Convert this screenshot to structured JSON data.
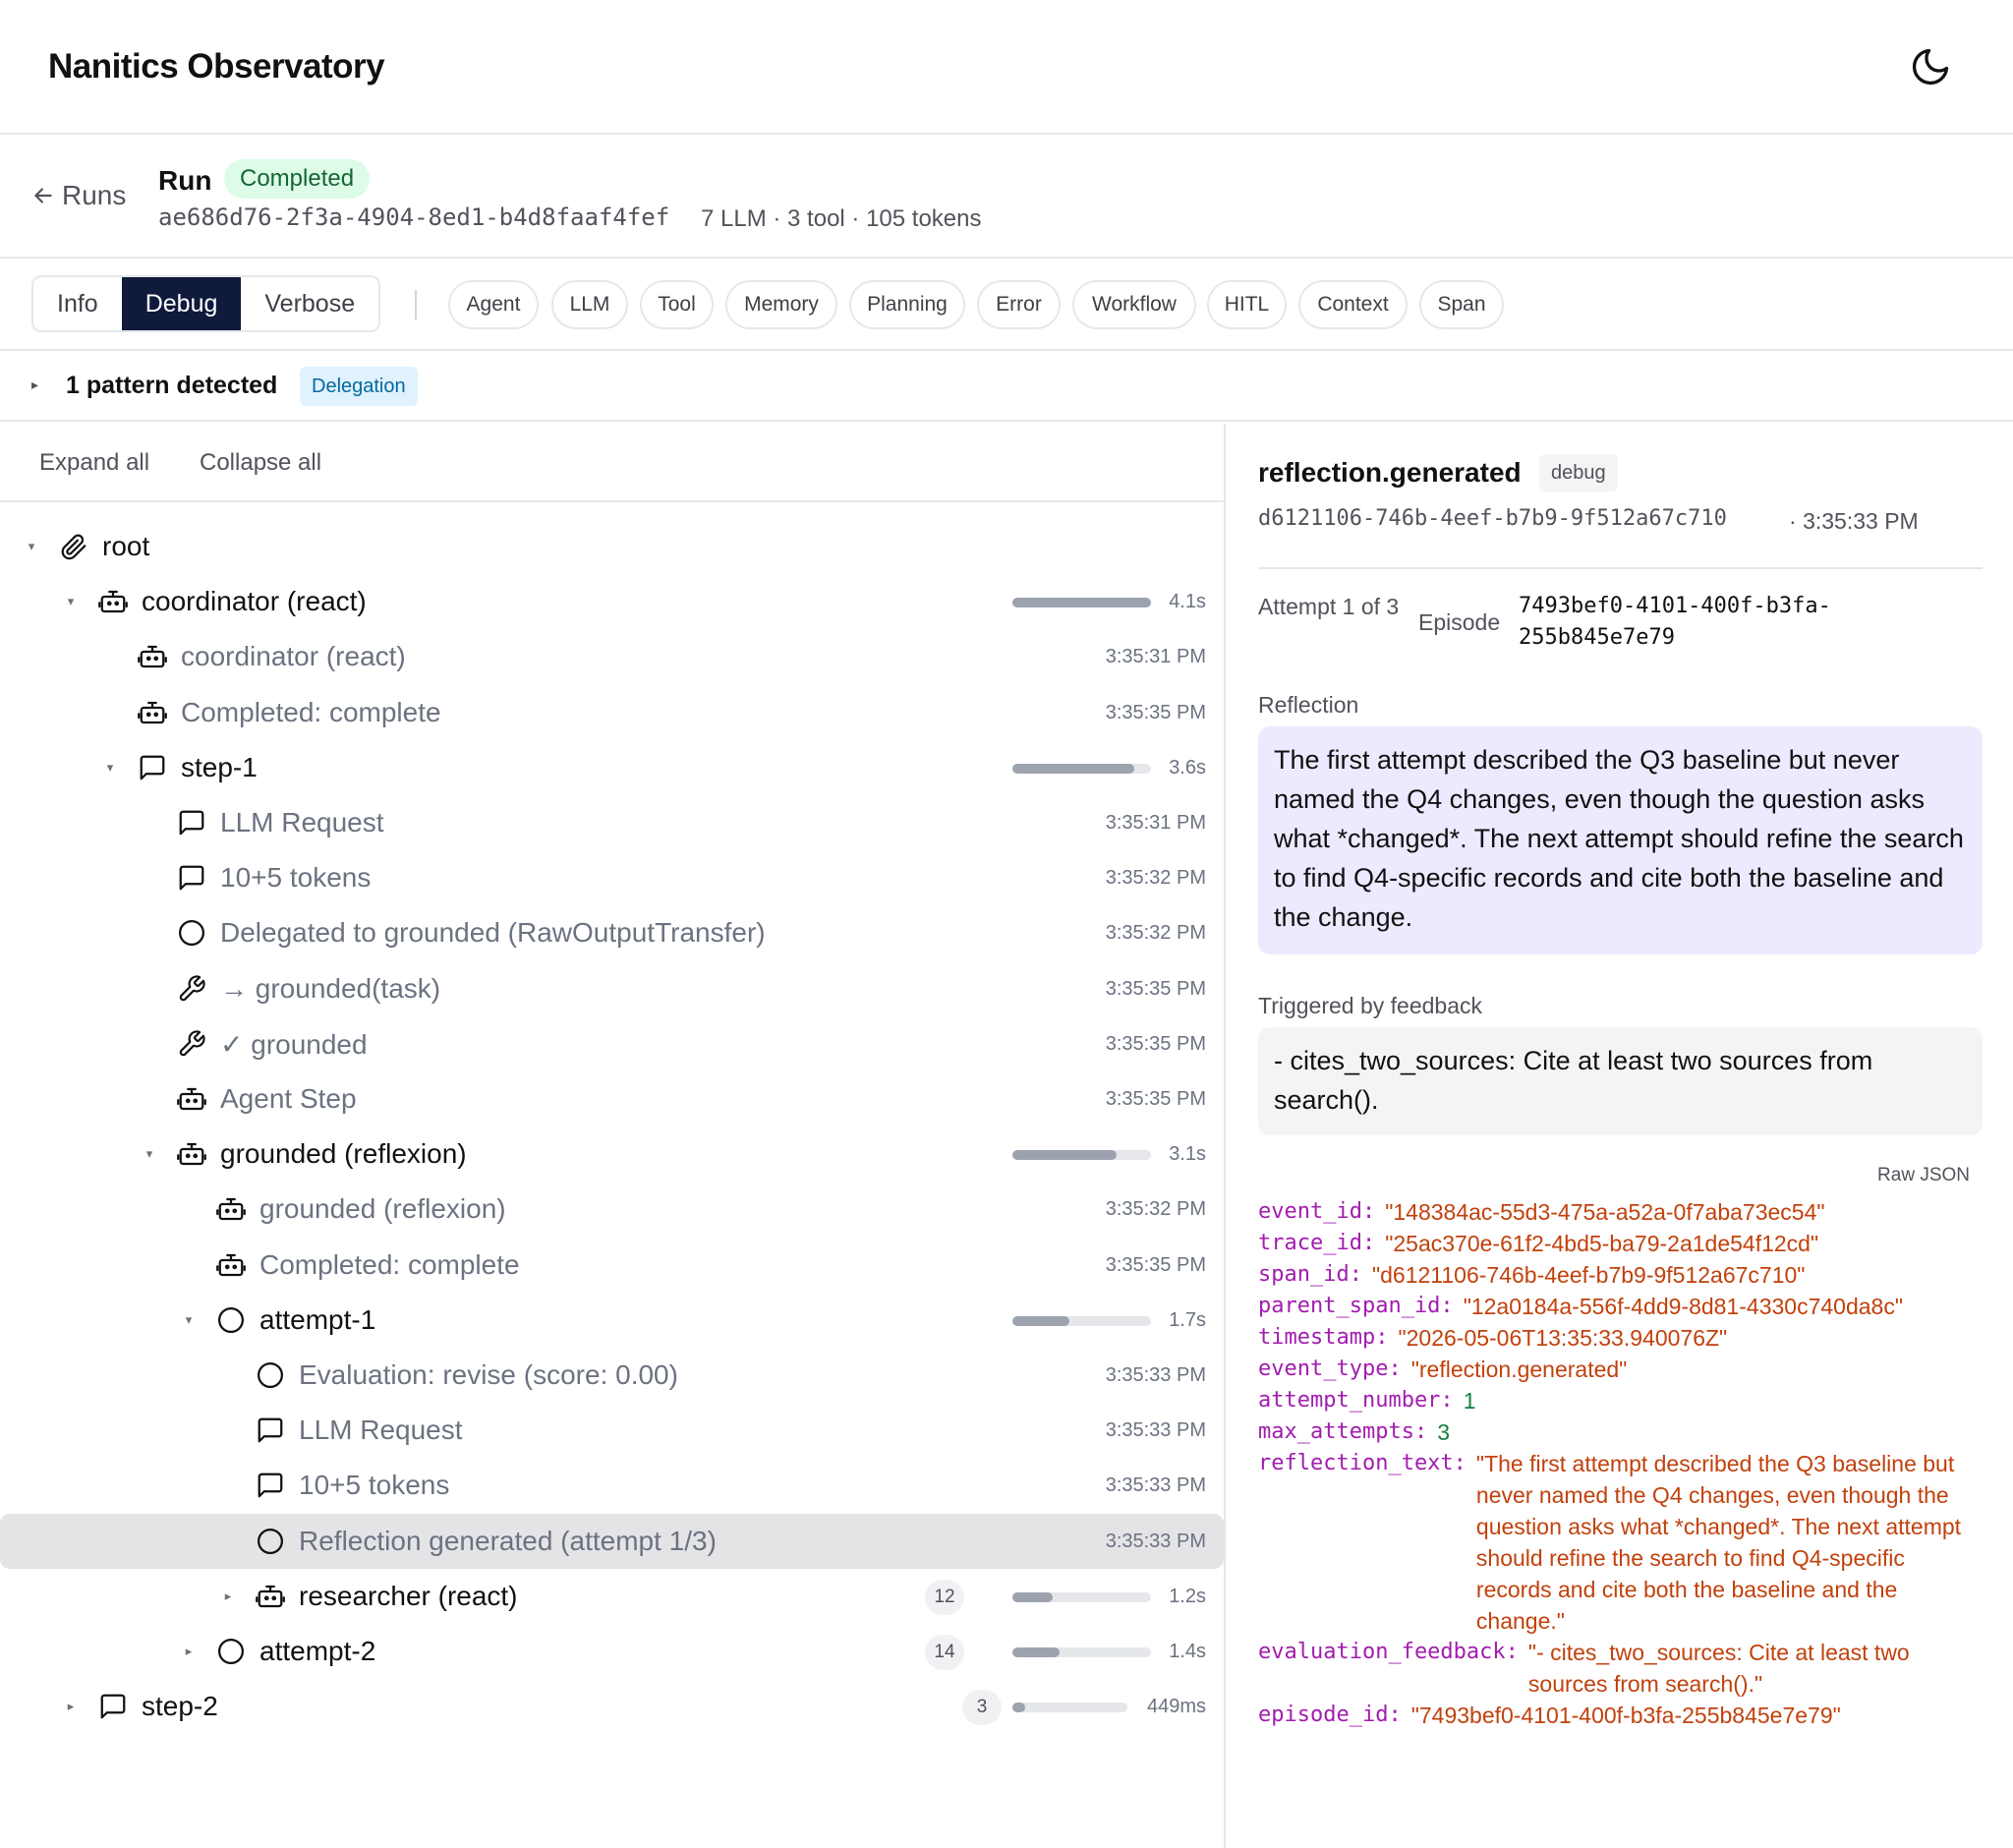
{
  "app": {
    "title": "Nanitics Observatory",
    "theme_icon": "moon-icon"
  },
  "run": {
    "back_label": "Runs",
    "label": "Run",
    "status": "Completed",
    "id": "ae686d76-2f3a-4904-8ed1-b4d8faaf4fef",
    "stats": "7 LLM · 3 tool · 105 tokens"
  },
  "levels": {
    "options": [
      "Info",
      "Debug",
      "Verbose"
    ],
    "selected": "Debug"
  },
  "filters": [
    "Agent",
    "LLM",
    "Tool",
    "Memory",
    "Planning",
    "Error",
    "Workflow",
    "HITL",
    "Context",
    "Span"
  ],
  "patterns": {
    "summary": "1 pattern detected",
    "badge": "Delegation"
  },
  "tree_toolbar": {
    "expand_all": "Expand all",
    "collapse_all": "Collapse all"
  },
  "tree": [
    {
      "label": "root",
      "icon": "paperclip-icon",
      "expandable": true,
      "expanded": true,
      "style": "strong"
    },
    {
      "label": "coordinator (react)",
      "icon": "robot-icon",
      "expandable": true,
      "expanded": true,
      "style": "strong",
      "duration": "4.1s",
      "fraction": 1.0
    },
    {
      "label": "coordinator (react)",
      "icon": "robot-icon",
      "style": "dim",
      "time": "3:35:31 PM"
    },
    {
      "label": "Completed: complete",
      "icon": "robot-icon",
      "style": "dim",
      "time": "3:35:35 PM"
    },
    {
      "label": "step-1",
      "icon": "message-square-icon",
      "expandable": true,
      "expanded": true,
      "style": "strong",
      "duration": "3.6s",
      "fraction": 0.88
    },
    {
      "label": "LLM Request",
      "icon": "message-square-icon",
      "style": "dim",
      "time": "3:35:31 PM"
    },
    {
      "label": "10+5 tokens",
      "icon": "message-square-icon",
      "style": "dim",
      "time": "3:35:32 PM"
    },
    {
      "label": "Delegated to grounded (RawOutputTransfer)",
      "icon": "circle-icon",
      "style": "dim",
      "time": "3:35:32 PM"
    },
    {
      "label": "→ grounded(task)",
      "icon": "wrench-icon",
      "style": "dim",
      "time": "3:35:35 PM"
    },
    {
      "label": "✓ grounded",
      "icon": "wrench-icon",
      "style": "dim",
      "time": "3:35:35 PM"
    },
    {
      "label": "Agent Step",
      "icon": "robot-icon",
      "style": "dim",
      "time": "3:35:35 PM"
    },
    {
      "label": "grounded (reflexion)",
      "icon": "robot-icon",
      "expandable": true,
      "expanded": true,
      "style": "strong",
      "duration": "3.1s",
      "fraction": 0.75
    },
    {
      "label": "grounded (reflexion)",
      "icon": "robot-icon",
      "style": "dim",
      "time": "3:35:32 PM"
    },
    {
      "label": "Completed: complete",
      "icon": "robot-icon",
      "style": "dim",
      "time": "3:35:35 PM"
    },
    {
      "label": "attempt-1",
      "icon": "circle-icon",
      "expandable": true,
      "expanded": true,
      "style": "strong",
      "duration": "1.7s",
      "fraction": 0.41
    },
    {
      "label": "Evaluation: revise (score: 0.00)",
      "icon": "circle-icon",
      "style": "dim",
      "time": "3:35:33 PM"
    },
    {
      "label": "LLM Request",
      "icon": "message-square-icon",
      "style": "dim",
      "time": "3:35:33 PM"
    },
    {
      "label": "10+5 tokens",
      "icon": "message-square-icon",
      "style": "dim",
      "time": "3:35:33 PM"
    },
    {
      "label": "Reflection generated (attempt 1/3)",
      "icon": "circle-icon",
      "style": "dim",
      "time": "3:35:33 PM",
      "selected": true
    },
    {
      "label": "researcher (react)",
      "icon": "robot-icon",
      "expandable": true,
      "expanded": false,
      "style": "strong",
      "count": "12",
      "duration": "1.2s",
      "fraction": 0.29
    },
    {
      "label": "attempt-2",
      "icon": "circle-icon",
      "expandable": true,
      "expanded": false,
      "style": "strong",
      "count": "14",
      "duration": "1.4s",
      "fraction": 0.34
    },
    {
      "label": "step-2",
      "icon": "message-square-icon",
      "expandable": true,
      "expanded": false,
      "style": "strong",
      "count": "3",
      "duration": "449ms",
      "fraction": 0.11
    }
  ],
  "event": {
    "title": "reflection.generated",
    "level": "debug",
    "span_id": "d6121106-746b-4eef-b7b9-9f512a67c710",
    "time": "3:35:33 PM",
    "attempt_label": "Attempt 1 of 3",
    "episode_label": "Episode",
    "episode_id": "7493bef0-4101-400f-b3fa-255b845e7e79",
    "reflection_label": "Reflection",
    "reflection_text": "The first attempt described the Q3 baseline but never named the Q4 changes, even though the question asks what *changed*. The next attempt should refine the search to find Q4-specific records and cite both the baseline and the change.",
    "feedback_label": "Triggered by feedback",
    "feedback_text": "- cites_two_sources: Cite at least two sources from search().",
    "raw_label": "Raw JSON",
    "raw_json": [
      {
        "key": "event_id:",
        "value": "\"148384ac-55d3-475a-a52a-0f7aba73ec54\"",
        "kind": "str"
      },
      {
        "key": "trace_id:",
        "value": "\"25ac370e-61f2-4bd5-ba79-2a1de54f12cd\"",
        "kind": "str"
      },
      {
        "key": "span_id:",
        "value": "\"d6121106-746b-4eef-b7b9-9f512a67c710\"",
        "kind": "str"
      },
      {
        "key": "parent_span_id:",
        "value": "\"12a0184a-556f-4dd9-8d81-4330c740da8c\"",
        "kind": "str"
      },
      {
        "key": "timestamp:",
        "value": "\"2026-05-06T13:35:33.940076Z\"",
        "kind": "str"
      },
      {
        "key": "event_type:",
        "value": "\"reflection.generated\"",
        "kind": "str"
      },
      {
        "key": "attempt_number:",
        "value": "1",
        "kind": "num"
      },
      {
        "key": "max_attempts:",
        "value": "3",
        "kind": "num"
      },
      {
        "key": "reflection_text:",
        "value": "\"The first attempt described the Q3 baseline but never named the Q4 changes, even though the question asks what *changed*. The next attempt should refine the search to find Q4-specific records and cite both the baseline and the change.\"",
        "kind": "str"
      },
      {
        "key": "evaluation_feedback:",
        "value": "\"- cites_two_sources: Cite at least two sources from search().\"",
        "kind": "str"
      },
      {
        "key": "episode_id:",
        "value": "\"7493bef0-4101-400f-b3fa-255b845e7e79\"",
        "kind": "str"
      }
    ]
  }
}
